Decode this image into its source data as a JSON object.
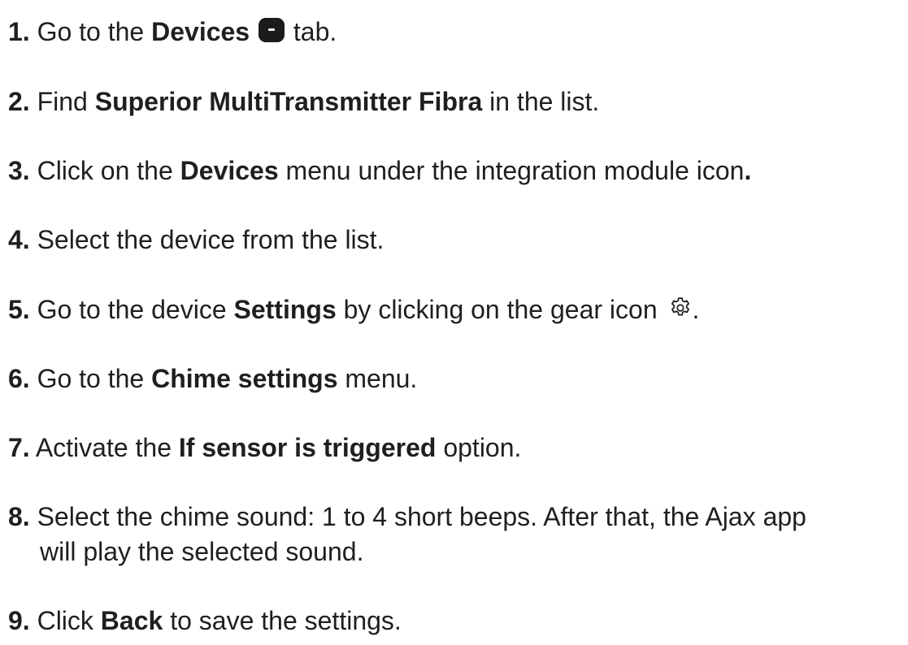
{
  "steps": [
    {
      "num": "1.",
      "pre": "Go to the ",
      "bold": "Devices",
      "post": " tab.",
      "icon": "device-tab-icon"
    },
    {
      "num": "2.",
      "pre": "Find ",
      "bold": "Superior MultiTransmitter Fibra",
      "post": " in the list."
    },
    {
      "num": "3.",
      "pre": "Click on the ",
      "bold": "Devices",
      "post": " menu under the integration module icon",
      "post2": "."
    },
    {
      "num": "4.",
      "text": "Select the device from the list."
    },
    {
      "num": "5.",
      "pre": "Go to the device ",
      "bold": "Settings",
      "post": " by clicking on the gear icon ",
      "icon": "gear-icon",
      "post2": "."
    },
    {
      "num": "6.",
      "pre": "Go to the ",
      "bold": "Chime settings",
      "post": " menu."
    },
    {
      "num": "7.",
      "pre": "Activate the ",
      "bold": "If sensor is triggered",
      "post": " option."
    },
    {
      "num": "8.",
      "line1": "Select the chime sound: 1 to 4 short beeps. After that, the Ajax app",
      "line2": "will play the selected sound."
    },
    {
      "num": "9.",
      "pre": "Click ",
      "bold": "Back",
      "post": " to save the settings."
    }
  ]
}
